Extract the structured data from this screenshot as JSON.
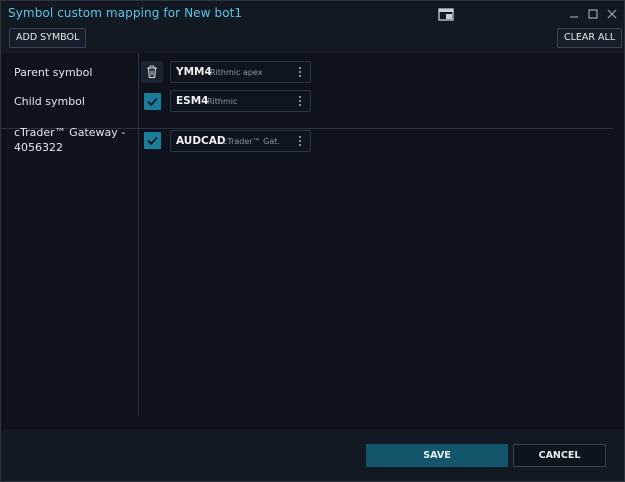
{
  "window": {
    "title": "Symbol custom mapping for New bot1"
  },
  "toolbar": {
    "add_symbol_label": "ADD SYMBOL",
    "clear_all_label": "CLEAR ALL"
  },
  "rows": [
    {
      "label": "Parent symbol",
      "symbol": "YMM4",
      "source": "Rithmic apex",
      "control": "delete"
    },
    {
      "label": "Child symbol",
      "symbol": "ESM4",
      "source": "Rithmic",
      "control": "checkbox",
      "checked": true
    },
    {
      "label": "cTrader™ Gateway - 4056322",
      "symbol": "AUDCAD",
      "source": "cTrader™ Gat.",
      "control": "checkbox",
      "checked": true
    }
  ],
  "footer": {
    "save_label": "SAVE",
    "cancel_label": "CANCEL"
  },
  "icons": {
    "dock": "dock-window-icon",
    "minimize": "minimize-icon",
    "maximize": "maximize-icon",
    "close": "close-icon",
    "trash": "trash-icon",
    "check": "checkmark-icon",
    "menu": "more-vertical-icon"
  },
  "colors": {
    "accent_title": "#5ec4e6",
    "checkbox": "#1a7e9a",
    "save_button": "#13566b",
    "background": "#0d121c"
  }
}
